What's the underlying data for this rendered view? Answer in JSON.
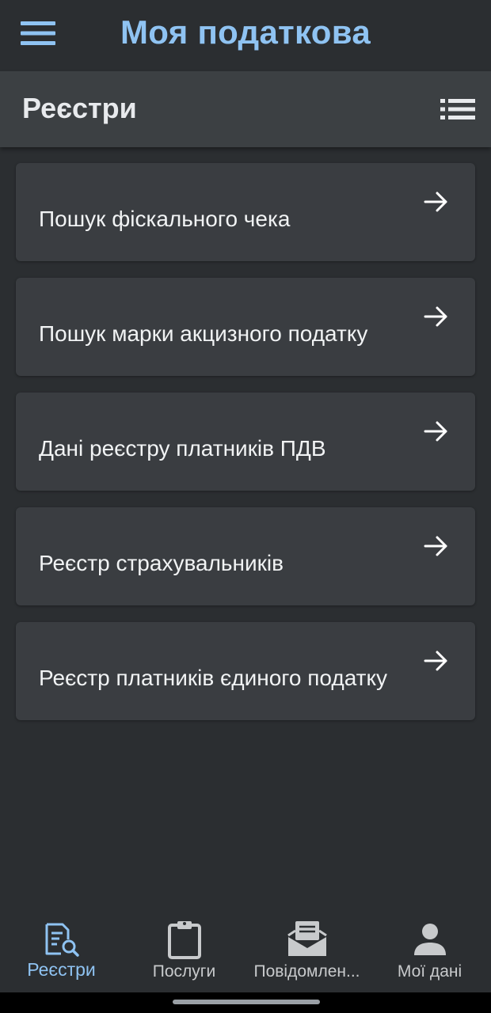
{
  "app": {
    "title": "Моя податкова",
    "accent_color": "#8fc3f2",
    "menu_icon": "hamburger-menu-icon"
  },
  "section": {
    "title": "Реєстри",
    "view_toggle_icon": "list-view-icon"
  },
  "cards": [
    {
      "label": "Пошук фіскального чека",
      "icon": "arrow-right-icon"
    },
    {
      "label": "Пошук марки акцизного податку",
      "icon": "arrow-right-icon"
    },
    {
      "label": "Дані реєстру платників ПДВ",
      "icon": "arrow-right-icon"
    },
    {
      "label": "Реєстр страхувальників",
      "icon": "arrow-right-icon"
    },
    {
      "label": "Реєстр платників єдиного податку",
      "icon": "arrow-right-icon"
    }
  ],
  "bottom_nav": {
    "items": [
      {
        "label": "Реєстри",
        "icon": "registry-search-icon",
        "active": true
      },
      {
        "label": "Послуги",
        "icon": "clipboard-icon",
        "active": false
      },
      {
        "label": "Повідомлен...",
        "icon": "mail-icon",
        "active": false
      },
      {
        "label": "Мої дані",
        "icon": "person-icon",
        "active": false
      }
    ]
  }
}
